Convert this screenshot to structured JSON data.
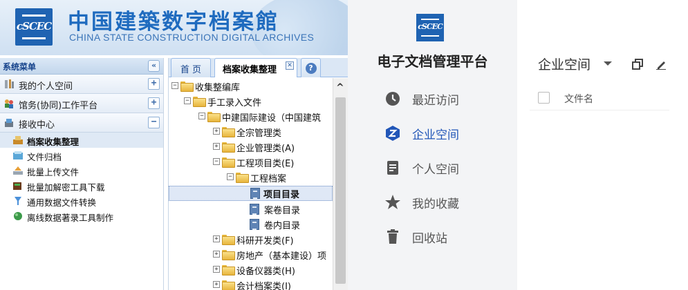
{
  "legacy": {
    "banner": {
      "logo_text": "cSCEC",
      "title_cn": "中国建築数字档案館",
      "title_en": "CHINA STATE CONSTRUCTION DIGITAL ARCHIVES",
      "brand_color": "#1f63b2"
    },
    "menu": {
      "header": "系统菜单",
      "collapse_glyph": "«",
      "groups": [
        {
          "label": "我的个人空间",
          "toggle": "+",
          "icon": "tools-icon"
        },
        {
          "label": "馆务(协同)工作平台",
          "toggle": "+",
          "icon": "people-icon"
        },
        {
          "label": "接收中心",
          "toggle": "−",
          "icon": "inbox-icon"
        }
      ],
      "items": [
        {
          "label": "档案收集整理",
          "icon": "archive-collect-icon",
          "active": true
        },
        {
          "label": "文件归档",
          "icon": "file-archive-icon"
        },
        {
          "label": "批量上传文件",
          "icon": "upload-icon"
        },
        {
          "label": "批量加解密工具下载",
          "icon": "download-tool-icon"
        },
        {
          "label": "通用数据文件转换",
          "icon": "convert-icon"
        },
        {
          "label": "离线数据著录工具制作",
          "icon": "globe-tool-icon"
        }
      ]
    },
    "tabs": {
      "home": "首 页",
      "active": "档案收集整理",
      "close_glyph": "✕",
      "help_glyph": "?"
    },
    "tree": [
      {
        "label": "收集整编库",
        "toggle": "−",
        "type": "folder"
      },
      {
        "label": "手工录入文件",
        "toggle": "−",
        "type": "folder"
      },
      {
        "label": "中建国际建设（中国建筑",
        "toggle": "−",
        "type": "folder"
      },
      {
        "label": "全宗管理类",
        "toggle": "+",
        "type": "folder"
      },
      {
        "label": "企业管理类(A)",
        "toggle": "+",
        "type": "folder"
      },
      {
        "label": "工程项目类(E)",
        "toggle": "−",
        "type": "folder"
      },
      {
        "label": "工程档案",
        "toggle": "−",
        "type": "folder"
      },
      {
        "label": "项目目录",
        "type": "doc",
        "selected": true
      },
      {
        "label": "案卷目录",
        "type": "doc"
      },
      {
        "label": "卷内目录",
        "type": "doc"
      },
      {
        "label": "科研开发类(F)",
        "toggle": "+",
        "type": "folder"
      },
      {
        "label": "房地产（基本建设）项",
        "toggle": "+",
        "type": "folder"
      },
      {
        "label": "设备仪器类(H)",
        "toggle": "+",
        "type": "folder"
      },
      {
        "label": "会计档案类(I)",
        "toggle": "+",
        "type": "folder"
      }
    ]
  },
  "modern": {
    "logo_text": "cSCEC",
    "platform_title": "电子文档管理平台",
    "nav": [
      {
        "label": "最近访问",
        "icon": "clock-icon"
      },
      {
        "label": "企业空间",
        "icon": "enterprise-hex-icon",
        "active": true
      },
      {
        "label": "个人空间",
        "icon": "document-icon"
      },
      {
        "label": "我的收藏",
        "icon": "star-icon"
      },
      {
        "label": "回收站",
        "icon": "trash-icon"
      }
    ],
    "workspace": {
      "selector_label": "企业空间",
      "column_filename": "文件名"
    },
    "accent_color": "#2156b8"
  }
}
